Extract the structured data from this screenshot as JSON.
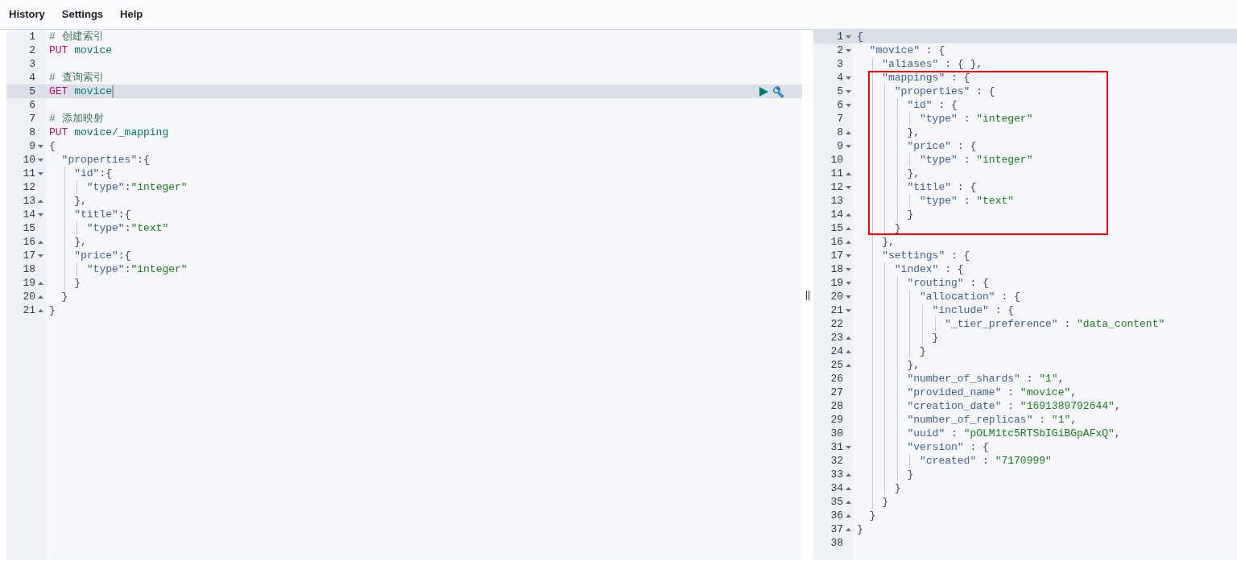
{
  "menu": [
    {
      "label": "History"
    },
    {
      "label": "Settings"
    },
    {
      "label": "Help"
    }
  ],
  "request_editor": {
    "lines": [
      {
        "number": "1",
        "tokens": [
          {
            "kind": "comment",
            "text": "# 创建索引"
          }
        ]
      },
      {
        "number": "2",
        "tokens": [
          {
            "kind": "method",
            "text": "PUT"
          },
          {
            "kind": "url",
            "text": " movice"
          }
        ]
      },
      {
        "number": "3"
      },
      {
        "number": "4",
        "tokens": [
          {
            "kind": "comment",
            "text": "# 查询索引"
          }
        ]
      },
      {
        "number": "5",
        "active": true,
        "cursor": true,
        "actions": true,
        "tokens": [
          {
            "kind": "method",
            "text": "GET"
          },
          {
            "kind": "url",
            "text": " movice"
          }
        ]
      },
      {
        "number": "6"
      },
      {
        "number": "7",
        "tokens": [
          {
            "kind": "comment",
            "text": "# 添加映射"
          }
        ]
      },
      {
        "number": "8",
        "tokens": [
          {
            "kind": "method",
            "text": "PUT"
          },
          {
            "kind": "url",
            "text": " movice/_mapping"
          }
        ]
      },
      {
        "number": "9",
        "fold_start": true,
        "tokens": [
          {
            "kind": "punct",
            "text": "{"
          }
        ]
      },
      {
        "number": "10",
        "fold_start": true,
        "tokens": [
          {
            "kind": "key",
            "text": "  \"properties\""
          },
          {
            "kind": "punct",
            "text": ":{"
          }
        ]
      },
      {
        "number": "11",
        "fold_start": true,
        "tokens": [
          {
            "kind": "key",
            "text": "    \"id\""
          },
          {
            "kind": "punct",
            "text": ":{"
          }
        ]
      },
      {
        "number": "12",
        "tokens": [
          {
            "kind": "key",
            "text": "      \"type\""
          },
          {
            "kind": "punct",
            "text": ":"
          },
          {
            "kind": "string",
            "text": "\"integer\""
          }
        ]
      },
      {
        "number": "13",
        "fold_end": true,
        "tokens": [
          {
            "kind": "punct",
            "text": "    },"
          }
        ]
      },
      {
        "number": "14",
        "fold_start": true,
        "tokens": [
          {
            "kind": "key",
            "text": "    \"title\""
          },
          {
            "kind": "punct",
            "text": ":{"
          }
        ]
      },
      {
        "number": "15",
        "tokens": [
          {
            "kind": "key",
            "text": "      \"type\""
          },
          {
            "kind": "punct",
            "text": ":"
          },
          {
            "kind": "string",
            "text": "\"text\""
          }
        ]
      },
      {
        "number": "16",
        "fold_end": true,
        "tokens": [
          {
            "kind": "punct",
            "text": "    },"
          }
        ]
      },
      {
        "number": "17",
        "fold_start": true,
        "tokens": [
          {
            "kind": "key",
            "text": "    \"price\""
          },
          {
            "kind": "punct",
            "text": ":{"
          }
        ]
      },
      {
        "number": "18",
        "tokens": [
          {
            "kind": "key",
            "text": "      \"type\""
          },
          {
            "kind": "punct",
            "text": ":"
          },
          {
            "kind": "string",
            "text": "\"integer\""
          }
        ]
      },
      {
        "number": "19",
        "fold_end": true,
        "tokens": [
          {
            "kind": "punct",
            "text": "    }"
          }
        ]
      },
      {
        "number": "20",
        "fold_end": true,
        "tokens": [
          {
            "kind": "punct",
            "text": "  }"
          }
        ]
      },
      {
        "number": "21",
        "fold_end": true,
        "tokens": [
          {
            "kind": "punct",
            "text": "}"
          }
        ]
      }
    ]
  },
  "response_viewer": {
    "lines": [
      {
        "number": "1",
        "active": true,
        "fold_start": true,
        "tokens": [
          {
            "kind": "punct",
            "text": "{"
          }
        ]
      },
      {
        "number": "2",
        "fold_start": true,
        "tokens": [
          {
            "kind": "key",
            "text": "  \"movice\""
          },
          {
            "kind": "punct",
            "text": " : {"
          }
        ]
      },
      {
        "number": "3",
        "tokens": [
          {
            "kind": "key",
            "text": "    \"aliases\""
          },
          {
            "kind": "punct",
            "text": " : { },"
          }
        ]
      },
      {
        "number": "4",
        "boxed": true,
        "fold_start": true,
        "tokens": [
          {
            "kind": "key",
            "text": "    \"mappings\""
          },
          {
            "kind": "punct",
            "text": " : {"
          }
        ]
      },
      {
        "number": "5",
        "boxed": true,
        "fold_start": true,
        "tokens": [
          {
            "kind": "key",
            "text": "      \"properties\""
          },
          {
            "kind": "punct",
            "text": " : {"
          }
        ]
      },
      {
        "number": "6",
        "boxed": true,
        "fold_start": true,
        "tokens": [
          {
            "kind": "key",
            "text": "        \"id\""
          },
          {
            "kind": "punct",
            "text": " : {"
          }
        ]
      },
      {
        "number": "7",
        "boxed": true,
        "tokens": [
          {
            "kind": "key",
            "text": "          \"type\""
          },
          {
            "kind": "punct",
            "text": " : "
          },
          {
            "kind": "string",
            "text": "\"integer\""
          }
        ]
      },
      {
        "number": "8",
        "boxed": true,
        "fold_end": true,
        "tokens": [
          {
            "kind": "punct",
            "text": "        },"
          }
        ]
      },
      {
        "number": "9",
        "boxed": true,
        "fold_start": true,
        "tokens": [
          {
            "kind": "key",
            "text": "        \"price\""
          },
          {
            "kind": "punct",
            "text": " : {"
          }
        ]
      },
      {
        "number": "10",
        "boxed": true,
        "tokens": [
          {
            "kind": "key",
            "text": "          \"type\""
          },
          {
            "kind": "punct",
            "text": " : "
          },
          {
            "kind": "string",
            "text": "\"integer\""
          }
        ]
      },
      {
        "number": "11",
        "boxed": true,
        "fold_end": true,
        "tokens": [
          {
            "kind": "punct",
            "text": "        },"
          }
        ]
      },
      {
        "number": "12",
        "boxed": true,
        "fold_start": true,
        "tokens": [
          {
            "kind": "key",
            "text": "        \"title\""
          },
          {
            "kind": "punct",
            "text": " : {"
          }
        ]
      },
      {
        "number": "13",
        "boxed": true,
        "tokens": [
          {
            "kind": "key",
            "text": "          \"type\""
          },
          {
            "kind": "punct",
            "text": " : "
          },
          {
            "kind": "string",
            "text": "\"text\""
          }
        ]
      },
      {
        "number": "14",
        "boxed": true,
        "fold_end": true,
        "tokens": [
          {
            "kind": "punct",
            "text": "        }"
          }
        ]
      },
      {
        "number": "15",
        "boxed": true,
        "fold_end": true,
        "tokens": [
          {
            "kind": "punct",
            "text": "      }"
          }
        ]
      },
      {
        "number": "16",
        "fold_end": true,
        "tokens": [
          {
            "kind": "punct",
            "text": "    },"
          }
        ]
      },
      {
        "number": "17",
        "fold_start": true,
        "tokens": [
          {
            "kind": "key",
            "text": "    \"settings\""
          },
          {
            "kind": "punct",
            "text": " : {"
          }
        ]
      },
      {
        "number": "18",
        "fold_start": true,
        "tokens": [
          {
            "kind": "key",
            "text": "      \"index\""
          },
          {
            "kind": "punct",
            "text": " : {"
          }
        ]
      },
      {
        "number": "19",
        "fold_start": true,
        "tokens": [
          {
            "kind": "key",
            "text": "        \"routing\""
          },
          {
            "kind": "punct",
            "text": " : {"
          }
        ]
      },
      {
        "number": "20",
        "fold_start": true,
        "tokens": [
          {
            "kind": "key",
            "text": "          \"allocation\""
          },
          {
            "kind": "punct",
            "text": " : {"
          }
        ]
      },
      {
        "number": "21",
        "fold_start": true,
        "tokens": [
          {
            "kind": "key",
            "text": "            \"include\""
          },
          {
            "kind": "punct",
            "text": " : {"
          }
        ]
      },
      {
        "number": "22",
        "tokens": [
          {
            "kind": "key",
            "text": "              \"_tier_preference\""
          },
          {
            "kind": "punct",
            "text": " : "
          },
          {
            "kind": "string",
            "text": "\"data_content\""
          }
        ]
      },
      {
        "number": "23",
        "fold_end": true,
        "tokens": [
          {
            "kind": "punct",
            "text": "            }"
          }
        ]
      },
      {
        "number": "24",
        "fold_end": true,
        "tokens": [
          {
            "kind": "punct",
            "text": "          }"
          }
        ]
      },
      {
        "number": "25",
        "fold_end": true,
        "tokens": [
          {
            "kind": "punct",
            "text": "        },"
          }
        ]
      },
      {
        "number": "26",
        "tokens": [
          {
            "kind": "key",
            "text": "        \"number_of_shards\""
          },
          {
            "kind": "punct",
            "text": " : "
          },
          {
            "kind": "string",
            "text": "\"1\""
          },
          {
            "kind": "punct",
            "text": ","
          }
        ]
      },
      {
        "number": "27",
        "tokens": [
          {
            "kind": "key",
            "text": "        \"provided_name\""
          },
          {
            "kind": "punct",
            "text": " : "
          },
          {
            "kind": "string",
            "text": "\"movice\""
          },
          {
            "kind": "punct",
            "text": ","
          }
        ]
      },
      {
        "number": "28",
        "tokens": [
          {
            "kind": "key",
            "text": "        \"creation_date\""
          },
          {
            "kind": "punct",
            "text": " : "
          },
          {
            "kind": "string",
            "text": "\"1691389792644\""
          },
          {
            "kind": "punct",
            "text": ","
          }
        ]
      },
      {
        "number": "29",
        "tokens": [
          {
            "kind": "key",
            "text": "        \"number_of_replicas\""
          },
          {
            "kind": "punct",
            "text": " : "
          },
          {
            "kind": "string",
            "text": "\"1\""
          },
          {
            "kind": "punct",
            "text": ","
          }
        ]
      },
      {
        "number": "30",
        "tokens": [
          {
            "kind": "key",
            "text": "        \"uuid\""
          },
          {
            "kind": "punct",
            "text": " : "
          },
          {
            "kind": "string",
            "text": "\"pOLM1tc5RTSbIGiBGpAFxQ\""
          },
          {
            "kind": "punct",
            "text": ","
          }
        ]
      },
      {
        "number": "31",
        "fold_start": true,
        "tokens": [
          {
            "kind": "key",
            "text": "        \"version\""
          },
          {
            "kind": "punct",
            "text": " : {"
          }
        ]
      },
      {
        "number": "32",
        "tokens": [
          {
            "kind": "key",
            "text": "          \"created\""
          },
          {
            "kind": "punct",
            "text": " : "
          },
          {
            "kind": "string",
            "text": "\"7170999\""
          }
        ]
      },
      {
        "number": "33",
        "fold_end": true,
        "tokens": [
          {
            "kind": "punct",
            "text": "        }"
          }
        ]
      },
      {
        "number": "34",
        "fold_end": true,
        "tokens": [
          {
            "kind": "punct",
            "text": "      }"
          }
        ]
      },
      {
        "number": "35",
        "fold_end": true,
        "tokens": [
          {
            "kind": "punct",
            "text": "    }"
          }
        ]
      },
      {
        "number": "36",
        "fold_end": true,
        "tokens": [
          {
            "kind": "punct",
            "text": "  }"
          }
        ]
      },
      {
        "number": "37",
        "fold_end": true,
        "tokens": [
          {
            "kind": "punct",
            "text": "}"
          }
        ]
      },
      {
        "number": "38"
      }
    ]
  }
}
